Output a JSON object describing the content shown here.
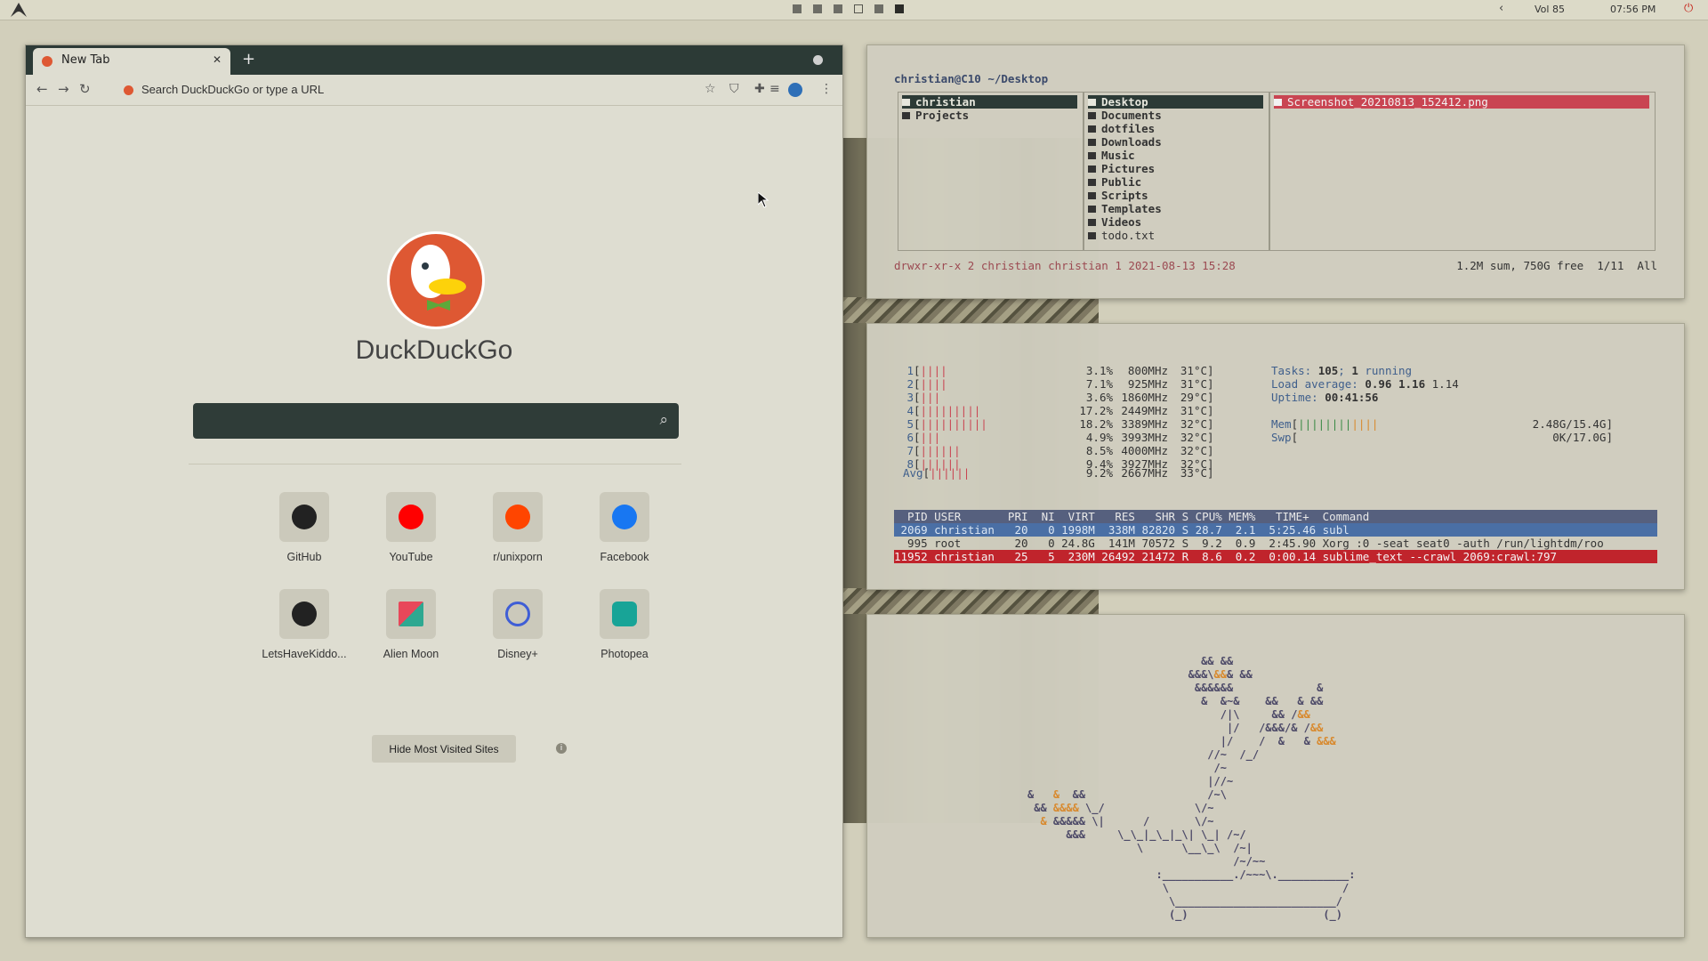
{
  "topbar": {
    "workspace_states": [
      "filled",
      "filled",
      "filled",
      "empty",
      "filled",
      "active"
    ],
    "volume": "Vol 85",
    "time": "07:56 PM"
  },
  "browser": {
    "tab_title": "New Tab",
    "url_placeholder": "Search DuckDuckGo or type a URL",
    "brand_name": "DuckDuckGo",
    "tiles": [
      {
        "label": "GitHub",
        "icon": "github-icon",
        "color": "#222222"
      },
      {
        "label": "YouTube",
        "icon": "youtube-icon",
        "color": "#ff0000"
      },
      {
        "label": "r/unixporn",
        "icon": "reddit-icon",
        "color": "#ff4500"
      },
      {
        "label": "Facebook",
        "icon": "facebook-icon",
        "color": "#1877f2"
      },
      {
        "label": "LetsHaveKiddo...",
        "icon": "github-icon",
        "color": "#222222"
      },
      {
        "label": "Alien Moon",
        "icon": "alien-moon-icon",
        "color": "#e8475a"
      },
      {
        "label": "Disney+",
        "icon": "disney-plus-icon",
        "color": "#3f5ed6"
      },
      {
        "label": "Photopea",
        "icon": "photopea-icon",
        "color": "#18a497"
      }
    ],
    "hide_button": "Hide Most Visited Sites"
  },
  "ranger": {
    "prompt": "christian@C10 ~/Desktop",
    "parent_items": [
      "christian",
      "Projects"
    ],
    "current_items": [
      "Desktop",
      "Documents",
      "dotfiles",
      "Downloads",
      "Music",
      "Pictures",
      "Public",
      "Scripts",
      "Templates",
      "Videos",
      "todo.txt"
    ],
    "preview_items": [
      "Screenshot_20210813_152412.png"
    ],
    "status_left": "drwxr-xr-x 2 christian christian 1 2021-08-13 15:28",
    "status_right": "1.2M sum, 750G free  1/11  All"
  },
  "htop": {
    "cpus": [
      {
        "id": "1",
        "bar": "||||",
        "pct": "3.1%",
        "freq": "800MHz",
        "temp": "31°C"
      },
      {
        "id": "2",
        "bar": "||||",
        "pct": "7.1%",
        "freq": "925MHz",
        "temp": "31°C"
      },
      {
        "id": "3",
        "bar": "|||",
        "pct": "3.6%",
        "freq": "1860MHz",
        "temp": "29°C"
      },
      {
        "id": "4",
        "bar": "|||||||||",
        "pct": "17.2%",
        "freq": "2449MHz",
        "temp": "31°C"
      },
      {
        "id": "5",
        "bar": "||||||||||",
        "pct": "18.2%",
        "freq": "3389MHz",
        "temp": "32°C"
      },
      {
        "id": "6",
        "bar": "|||",
        "pct": "4.9%",
        "freq": "3993MHz",
        "temp": "32°C"
      },
      {
        "id": "7",
        "bar": "||||||",
        "pct": "8.5%",
        "freq": "4000MHz",
        "temp": "32°C"
      },
      {
        "id": "8",
        "bar": "||||||",
        "pct": "9.4%",
        "freq": "3927MHz",
        "temp": "32°C"
      }
    ],
    "avg": {
      "bar": "||||||",
      "pct": "9.2%",
      "freq": "2667MHz",
      "temp": "33°C"
    },
    "tasks": "105",
    "running": "1",
    "load": [
      "0.96",
      "1.16",
      "1.14"
    ],
    "uptime": "00:41:56",
    "mem": "2.48G/15.4G",
    "swp": "0K/17.0G",
    "header": "  PID USER       PRI  NI  VIRT   RES   SHR S CPU% MEM%   TIME+  Command",
    "processes": [
      " 2069 christian   20   0 1998M  338M 82820 S 28.7  2.1  5:25.46 subl",
      "  995 root        20   0 24.8G  141M 70572 S  9.2  0.9  2:45.90 Xorg :0 -seat seat0 -auth /run/lightdm/roo",
      "11952 christian   25   5  230M 26492 21472 R  8.6  0.2  0:00.14 sublime_text --crawl 2069:crawl:797"
    ]
  }
}
